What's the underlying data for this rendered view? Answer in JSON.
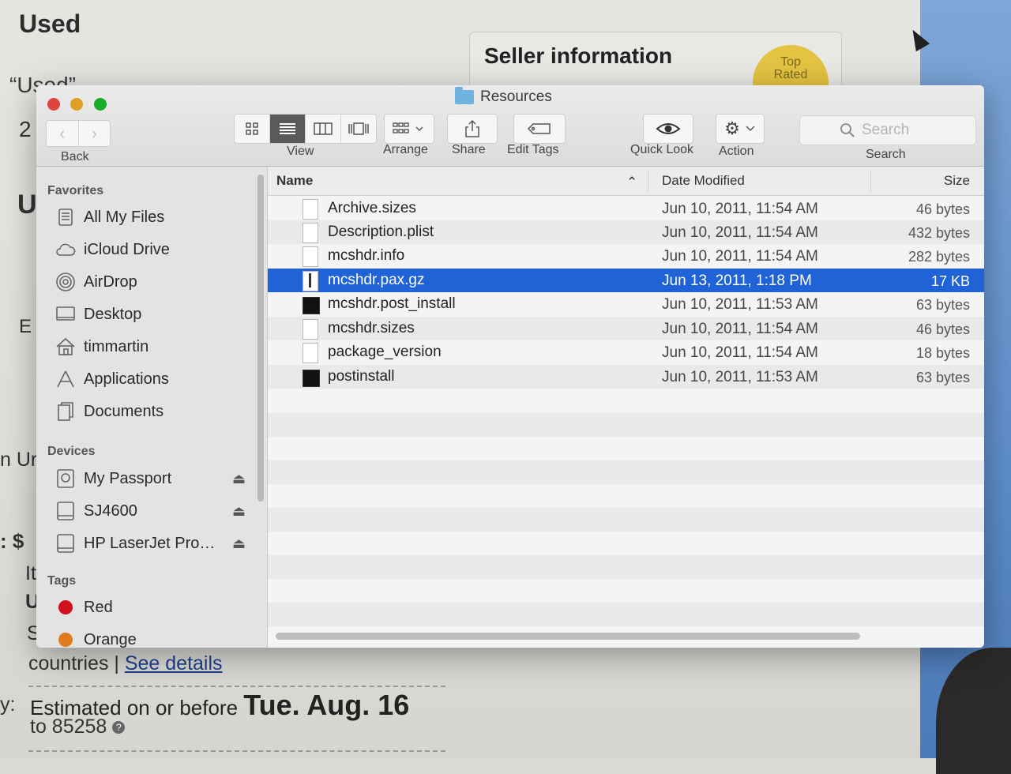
{
  "background": {
    "heading_used": "Used",
    "quote_used": "“Used”",
    "seller_title": "Seller information",
    "top_rated_line1": "Top",
    "top_rated_line2": "Rated",
    "frag_2": "2",
    "frag_u": "U",
    "frag_e": "E",
    "frag_nur": "n Ur",
    "frag_dollar": ": $",
    "frag_ite": "Ite",
    "frag_u2": "U",
    "frag_s": "S",
    "frag_y": "y:",
    "countries": "countries | ",
    "see_details": "See details",
    "estimated": "Estimated on or before ",
    "est_date": "Tue. Aug. 16",
    "zip": "to 85258"
  },
  "window": {
    "title": "Resources",
    "folder_icon": "folder-icon"
  },
  "toolbar": {
    "back_label": "Back",
    "view_label": "View",
    "arrange_label": "Arrange",
    "share_label": "Share",
    "edit_tags_label": "Edit Tags",
    "quick_look_label": "Quick Look",
    "action_label": "Action",
    "search_label": "Search",
    "search_placeholder": "Search"
  },
  "sidebar": {
    "favorites_heading": "Favorites",
    "favorites": [
      {
        "label": "All My Files",
        "icon": "all-files-icon"
      },
      {
        "label": "iCloud Drive",
        "icon": "cloud-icon"
      },
      {
        "label": "AirDrop",
        "icon": "airdrop-icon"
      },
      {
        "label": "Desktop",
        "icon": "desktop-icon"
      },
      {
        "label": "timmartin",
        "icon": "home-icon"
      },
      {
        "label": "Applications",
        "icon": "applications-icon"
      },
      {
        "label": "Documents",
        "icon": "documents-icon"
      }
    ],
    "devices_heading": "Devices",
    "devices": [
      {
        "label": "My Passport",
        "icon": "drive-icon"
      },
      {
        "label": "SJ4600",
        "icon": "drive-icon"
      },
      {
        "label": "HP LaserJet Pro…",
        "icon": "drive-icon"
      }
    ],
    "tags_heading": "Tags",
    "tags": [
      {
        "label": "Red",
        "color": "#d0101b"
      },
      {
        "label": "Orange",
        "color": "#e07a1c"
      }
    ],
    "eject_glyph": "⏏"
  },
  "columns": {
    "name": "Name",
    "date": "Date Modified",
    "size": "Size",
    "sort_arrow": "⌃"
  },
  "files": [
    {
      "name": "Archive.sizes",
      "date": "Jun 10, 2011, 11:54 AM",
      "size": "46 bytes",
      "icon": "document-icon"
    },
    {
      "name": "Description.plist",
      "date": "Jun 10, 2011, 11:54 AM",
      "size": "432 bytes",
      "icon": "document-icon"
    },
    {
      "name": "mcshdr.info",
      "date": "Jun 10, 2011, 11:54 AM",
      "size": "282 bytes",
      "icon": "document-icon"
    },
    {
      "name": "mcshdr.pax.gz",
      "date": "Jun 13, 2011, 1:18 PM",
      "size": "17 KB",
      "icon": "archive-icon",
      "selected": true
    },
    {
      "name": "mcshdr.post_install",
      "date": "Jun 10, 2011, 11:53 AM",
      "size": "63 bytes",
      "icon": "terminal-icon"
    },
    {
      "name": "mcshdr.sizes",
      "date": "Jun 10, 2011, 11:54 AM",
      "size": "46 bytes",
      "icon": "document-icon"
    },
    {
      "name": "package_version",
      "date": "Jun 10, 2011, 11:54 AM",
      "size": "18 bytes",
      "icon": "document-icon"
    },
    {
      "name": "postinstall",
      "date": "Jun 10, 2011, 11:53 AM",
      "size": "63 bytes",
      "icon": "terminal-icon"
    }
  ],
  "colors": {
    "selection": "#1f63d6",
    "close": "#e0443e",
    "minimize": "#dea123",
    "maximize": "#1aab29"
  }
}
